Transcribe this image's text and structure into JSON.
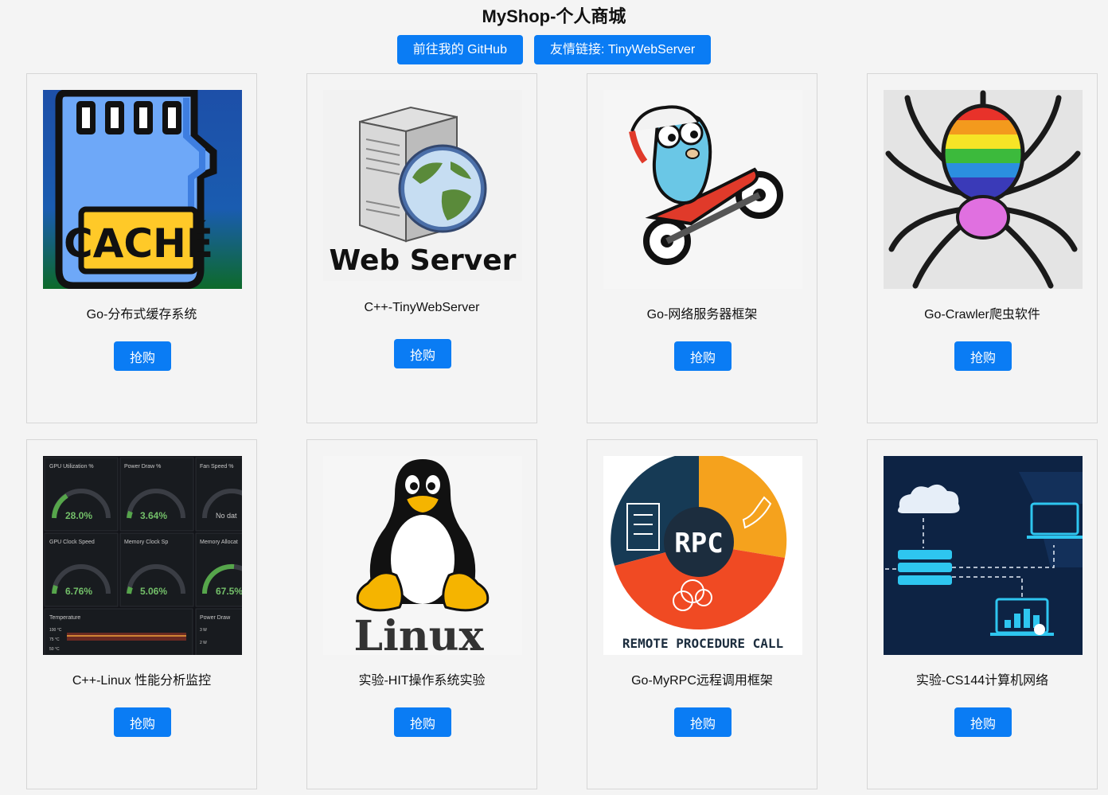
{
  "header": {
    "title": "MyShop-个人商城",
    "links": [
      {
        "label": "前往我的 GitHub"
      },
      {
        "label": "友情链接: TinyWebServer"
      }
    ]
  },
  "products": [
    {
      "name": "Go-分布式缓存系统",
      "buy_label": "抢购",
      "image_text": "CACHÉ"
    },
    {
      "name": "C++-TinyWebServer",
      "buy_label": "抢购",
      "image_text": "Web Server"
    },
    {
      "name": "Go-网络服务器框架",
      "buy_label": "抢购"
    },
    {
      "name": "Go-Crawler爬虫软件",
      "buy_label": "抢购"
    },
    {
      "name": "C++-Linux 性能分析监控",
      "buy_label": "抢购",
      "image_panels": [
        {
          "label": "GPU Utilization %",
          "value": "28.0%"
        },
        {
          "label": "Power Draw %",
          "value": "3.64%"
        },
        {
          "label": "Fan Speed %",
          "value": "No dat"
        },
        {
          "label": "GPU Clock Speed",
          "value": "6.76%"
        },
        {
          "label": "Memory Clock Sp",
          "value": "5.06%"
        },
        {
          "label": "Memory Allocat",
          "value": "67.5%"
        }
      ],
      "image_bottom": {
        "temperature": "Temperature",
        "power": "Power Draw",
        "t1": "100 °C",
        "t2": "75 °C",
        "t3": "50 °C",
        "p1": "3 W",
        "p2": "2 W"
      }
    },
    {
      "name": "实验-HIT操作系统实验",
      "buy_label": "抢购",
      "image_text": "Linux"
    },
    {
      "name": "Go-MyRPC远程调用框架",
      "buy_label": "抢购",
      "image_text": "RPC",
      "image_caption": "REMOTE PROCEDURE CALL"
    },
    {
      "name": "实验-CS144计算机网络",
      "buy_label": "抢购"
    }
  ]
}
